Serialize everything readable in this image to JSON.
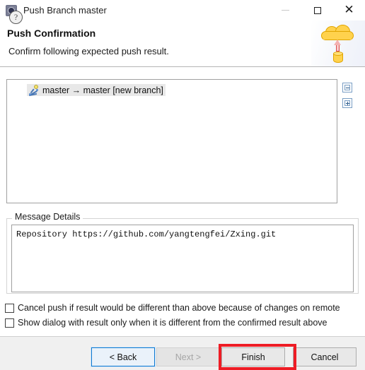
{
  "window": {
    "title": "Push Branch master",
    "icon": "push-branch-icon",
    "controls": {
      "minimize": "minimize-icon",
      "maximize": "maximize-icon",
      "close": "close-icon"
    }
  },
  "header": {
    "title": "Push Confirmation",
    "subtitle": "Confirm following expected push result.",
    "artwork": "cloud-upload-illustration"
  },
  "tree": {
    "items": [
      {
        "icon": "branch-ref-icon",
        "label": "master → master [new branch]",
        "selected": true
      }
    ],
    "side_buttons": [
      {
        "name": "collapse-all-button",
        "glyph": "minus"
      },
      {
        "name": "expand-all-button",
        "glyph": "plus"
      }
    ]
  },
  "message_details": {
    "group_label": "Message Details",
    "text": "Repository https://github.com/yangtengfei/Zxing.git"
  },
  "checkboxes": [
    {
      "label": "Cancel push if result would be different than above because of changes on remote",
      "checked": false
    },
    {
      "label": "Show dialog with result only when it is different from the confirmed result above",
      "checked": false
    }
  ],
  "footer": {
    "help_glyph": "?",
    "buttons": {
      "back": "< Back",
      "next": "Next >",
      "finish": "Finish",
      "cancel": "Cancel"
    },
    "next_disabled": true,
    "back_focused": true,
    "finish_highlighted": true
  },
  "colors": {
    "highlight_red": "#ee1c25",
    "focus_blue": "#0f7ad1",
    "cloud_yellow": "#ffd24d",
    "arrow_red": "#d94a4a",
    "selection_gray": "#e8e8e8"
  }
}
